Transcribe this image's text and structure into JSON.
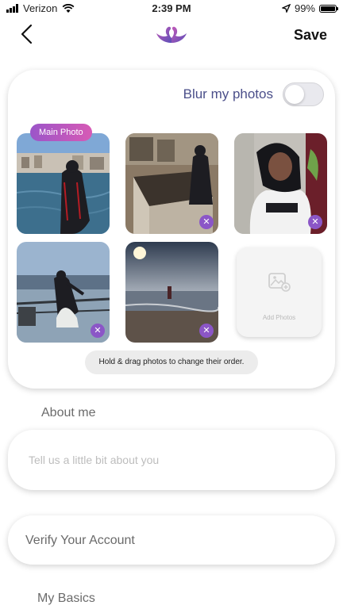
{
  "status": {
    "carrier": "Verizon",
    "time": "2:39 PM",
    "battery": "99%",
    "battery_fraction": 0.99
  },
  "nav": {
    "save_label": "Save"
  },
  "photos": {
    "blur_label": "Blur my photos",
    "blur_enabled": false,
    "main_tag": "Main Photo",
    "add_label": "Add Photos",
    "hint": "Hold & drag photos to change their order."
  },
  "about": {
    "title": "About me",
    "placeholder": "Tell us a little bit about you"
  },
  "verify": {
    "label": "Verify Your Account"
  },
  "basics": {
    "title": "My Basics"
  },
  "colors": {
    "accent": "#8b56c7",
    "label": "#4b4f8a",
    "tag_start": "#9b55c9",
    "tag_end": "#d75ab5"
  }
}
